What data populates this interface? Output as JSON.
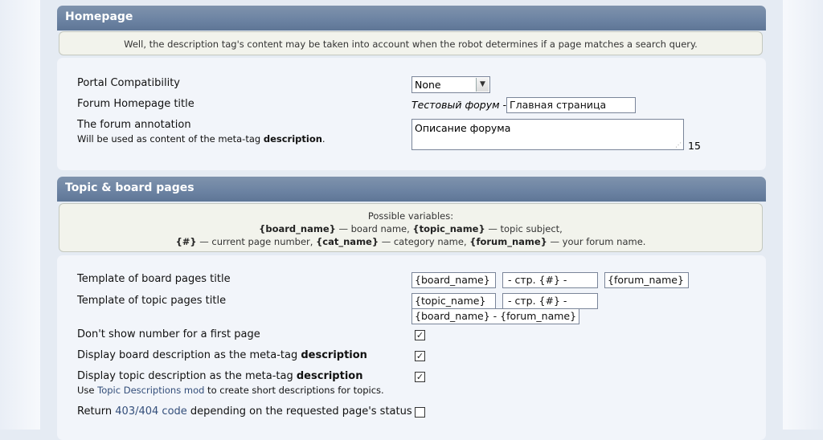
{
  "homepage": {
    "title": "Homepage",
    "info": "Well, the description tag's content may be taken into account when the robot determines if a page matches a search query.",
    "rows": {
      "portal_label": "Portal Compatibility",
      "portal_value": "None",
      "home_title_label": "Forum Homepage title",
      "home_title_prefix": "Тестовый форум -",
      "home_title_value": "Главная страница",
      "annotation_label": "The forum annotation",
      "annotation_sub_pre": "Will be used as content of the meta-tag ",
      "annotation_sub_bold": "description",
      "annotation_sub_post": ".",
      "annotation_value": "Описание форума",
      "annotation_count": "15"
    }
  },
  "topics": {
    "title": "Topic & board pages",
    "info_line1": "Possible variables:",
    "var_board_name": "{board_name}",
    "desc_board_name": " — board name, ",
    "var_topic_name": "{topic_name}",
    "desc_topic_name": " — topic subject,",
    "var_page": "{#}",
    "desc_page": " — current page number, ",
    "var_cat_name": "{cat_name}",
    "desc_cat_name": " — category name, ",
    "var_forum_name": "{forum_name}",
    "desc_forum_name": " — your forum name.",
    "board_tpl_label": "Template of board pages title",
    "board_tpl": [
      "{board_name}",
      "- стр. {#} -",
      "{forum_name}"
    ],
    "topic_tpl_label": "Template of topic pages title",
    "topic_tpl": [
      "{topic_name}",
      "- стр. {#} -",
      "{board_name} - {forum_name}"
    ],
    "first_page_label": "Don't show number for a first page",
    "first_page_checked": true,
    "board_desc_pre": "Display board description as the meta-tag ",
    "board_desc_bold": "description",
    "board_desc_checked": true,
    "topic_desc_pre": "Display topic description as the meta-tag ",
    "topic_desc_bold": "description",
    "topic_desc_checked": true,
    "topic_desc_sub_pre": "Use ",
    "topic_desc_sub_link": "Topic Descriptions mod",
    "topic_desc_sub_post": " to create short descriptions for topics.",
    "status_pre": "Return ",
    "status_link": "403/404 code",
    "status_post": " depending on the requested page's status",
    "status_checked": false
  }
}
